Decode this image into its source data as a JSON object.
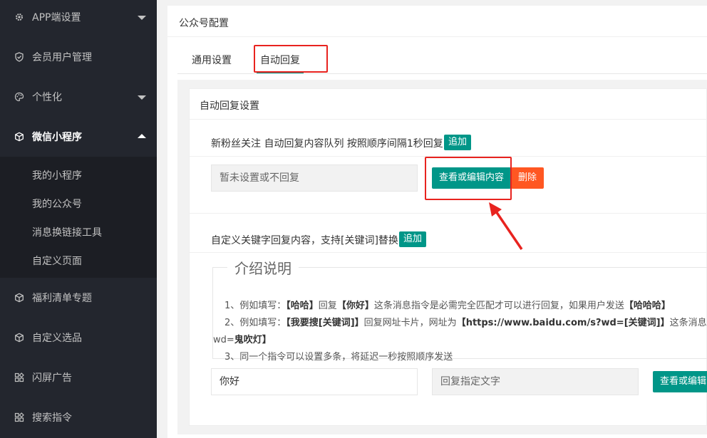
{
  "sidebar": {
    "items": [
      {
        "label": "APP端设置"
      },
      {
        "label": "会员用户管理"
      },
      {
        "label": "个性化"
      },
      {
        "label": "微信小程序"
      },
      {
        "label": "福利清单专题"
      },
      {
        "label": "自定义选品"
      },
      {
        "label": "闪屏广告"
      },
      {
        "label": "搜索指令"
      }
    ],
    "submenu": [
      {
        "label": "我的小程序"
      },
      {
        "label": "我的公众号"
      },
      {
        "label": "消息换链接工具"
      },
      {
        "label": "自定义页面"
      }
    ]
  },
  "panel": {
    "title": "公众号配置",
    "tabs": [
      {
        "label": "通用设置"
      },
      {
        "label": "自动回复"
      }
    ],
    "card_title": "自动回复设置",
    "follow": {
      "label": "新粉丝关注 自动回复内容队列 按照顺序间隔1秒回复",
      "add_label": "追加",
      "placeholder": "暂未设置或不回复",
      "view_label": "查看或编辑内容",
      "delete_label": "删除"
    },
    "keyword": {
      "label": "自定义关键字回复内容，支持[关键词]替换",
      "add_label": "追加",
      "legend": "介绍说明",
      "line1_a": "1、例如填写：",
      "line1_b": "【哈哈】",
      "line1_c": "回复",
      "line1_d": "【你好】",
      "line1_e": "这条消息指令是必需完全匹配才可以进行回复，如果用户发送",
      "line1_f": "【哈哈哈】",
      "line2_a": "2、例如填写：",
      "line2_b": "【我要搜[关键词]】",
      "line2_c": "回复网址卡片，网址为",
      "line2_d": "【https://www.baidu.com/s?wd=[关键词]】",
      "line2_e": "这条消息",
      "line3_a": "wd=",
      "line3_b": "鬼吹灯】",
      "line4": "3、同一个指令可以设置多条，将延迟一秒按照顺序发送",
      "keyword_value": "你好",
      "reply_placeholder": "回复指定文字",
      "view_label": "查看或编辑内容"
    }
  },
  "colors": {
    "sidebar_bg": "#23262e",
    "accent_green": "#009688",
    "delete_orange": "#ff5722",
    "highlight_red": "#e8231f"
  }
}
